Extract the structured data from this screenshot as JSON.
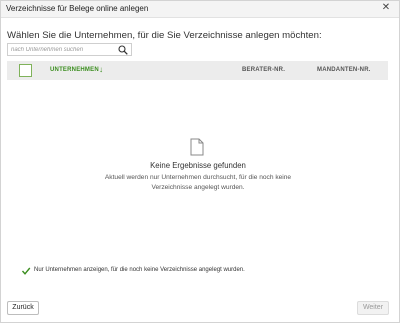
{
  "window": {
    "title": "Verzeichnisse für Belege online anlegen",
    "close_icon": "close-icon"
  },
  "instruction": "Wählen Sie die Unternehmen, für die Sie Verzeichnisse anlegen möchten:",
  "search": {
    "placeholder": "nach Unternehmen suchen",
    "value": "",
    "icon": "search-icon"
  },
  "table": {
    "columns": {
      "company": "UNTERNEHMEN",
      "berater": "BERATER-NR.",
      "mandanten": "MANDANTEN-NR."
    },
    "sort_icon": "sort-descending-arrow-icon",
    "select_all_checked": false,
    "rows": []
  },
  "empty_state": {
    "icon": "document-icon",
    "title": "Keine Ergebnisse gefunden",
    "description_line1": "Aktuell werden nur Unternehmen durchsucht, für die noch keine",
    "description_line2": "Verzeichnisse angelegt wurden."
  },
  "filter": {
    "checked": true,
    "label": "Nur Unternehmen anzeigen, für die noch keine Verzeichnisse angelegt wurden."
  },
  "buttons": {
    "back": "Zurück",
    "next": "Weiter",
    "next_enabled": false
  },
  "colors": {
    "accent_green": "#3a8d1e",
    "checkbox_border": "#7fb25a",
    "header_bg": "#ececec"
  }
}
